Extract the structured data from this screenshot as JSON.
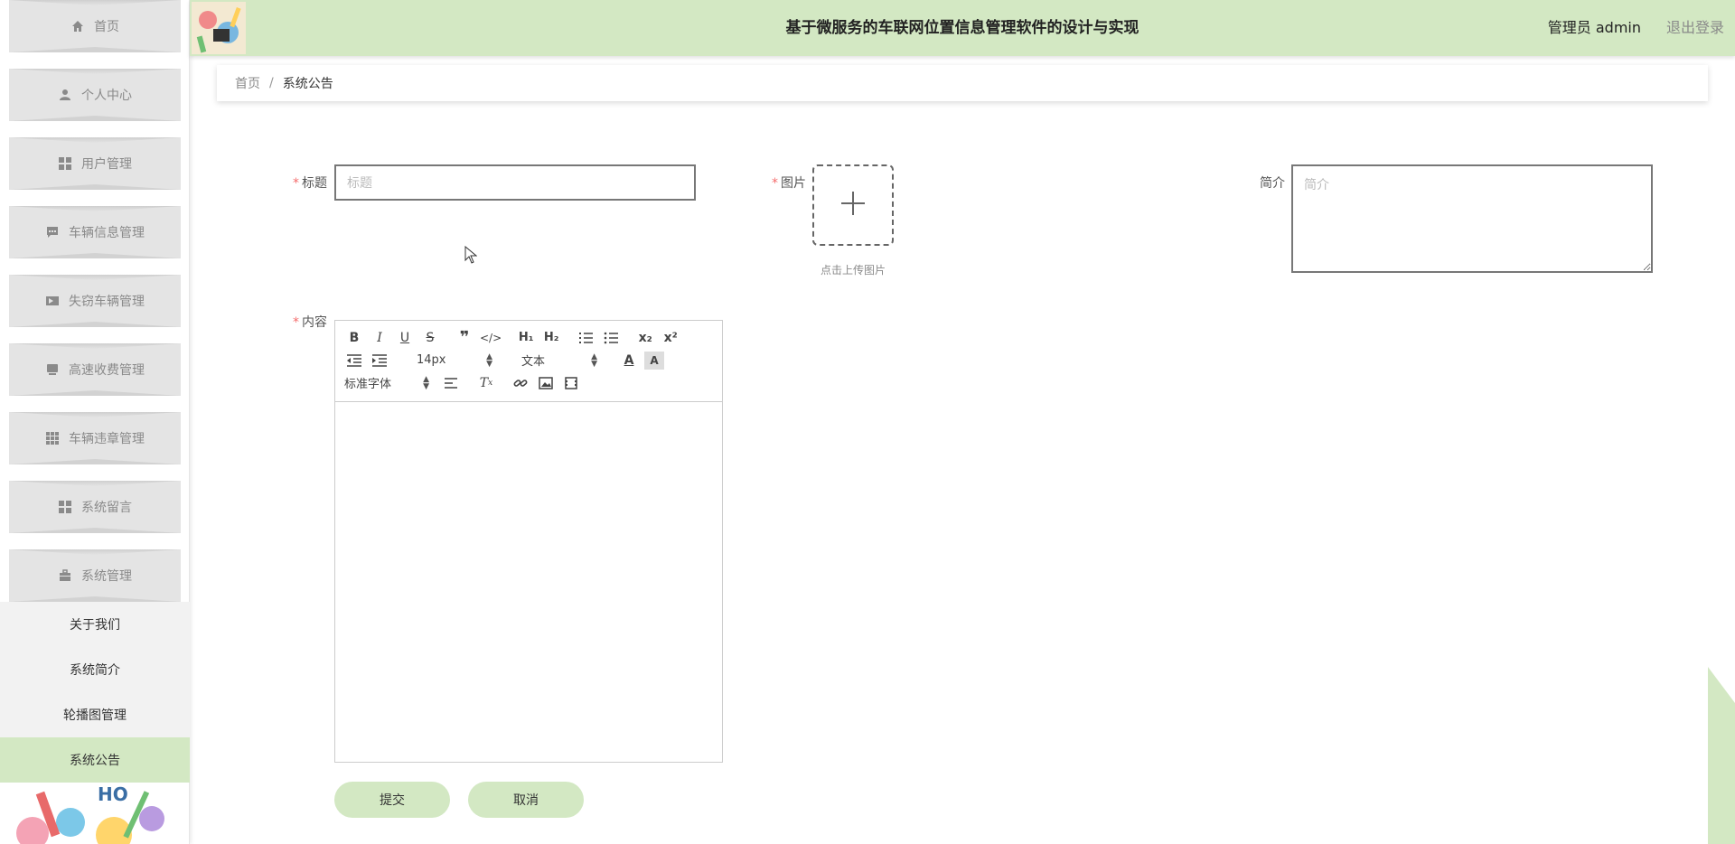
{
  "header": {
    "title": "基于微服务的车联网位置信息管理软件的设计与实现",
    "user": "管理员 admin",
    "logout": "退出登录",
    "bg_color": "#d3e8c3"
  },
  "sidebar": {
    "items": [
      {
        "label": "首页",
        "icon": "home-icon"
      },
      {
        "label": "个人中心",
        "icon": "user-icon"
      },
      {
        "label": "用户管理",
        "icon": "grid-icon"
      },
      {
        "label": "车辆信息管理",
        "icon": "chat-icon"
      },
      {
        "label": "失窃车辆管理",
        "icon": "ticket-icon"
      },
      {
        "label": "高速收费管理",
        "icon": "monitor-icon"
      },
      {
        "label": "车辆违章管理",
        "icon": "apps-icon"
      },
      {
        "label": "系统留言",
        "icon": "grid-icon"
      },
      {
        "label": "系统管理",
        "icon": "briefcase-icon"
      }
    ],
    "submenu": [
      "关于我们",
      "系统简介",
      "轮播图管理",
      "系统公告"
    ],
    "active_submenu": "系统公告"
  },
  "breadcrumb": {
    "home": "首页",
    "separator": "/",
    "current": "系统公告"
  },
  "form": {
    "title_label": "标题",
    "title_placeholder": "标题",
    "image_label": "图片",
    "upload_tip": "点击上传图片",
    "intro_label": "简介",
    "intro_placeholder": "简介",
    "content_label": "内容",
    "required_mark": "*",
    "editor": {
      "font_size": "14px",
      "header_select": "文本",
      "font_family": "标准字体"
    },
    "submit": "提交",
    "cancel": "取消"
  }
}
